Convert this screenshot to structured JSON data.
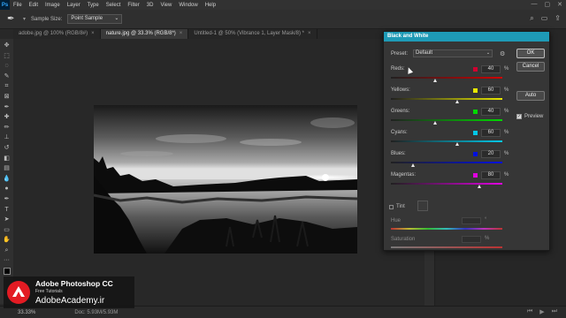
{
  "menubar": {
    "logo": "Ps",
    "items": [
      "File",
      "Edit",
      "Image",
      "Layer",
      "Type",
      "Select",
      "Filter",
      "3D",
      "View",
      "Window",
      "Help"
    ]
  },
  "options": {
    "sample_size_label": "Sample Size:",
    "sample_size_value": "Point Sample"
  },
  "tabs": [
    {
      "label": "adobe.jpg @ 100% (RGB/8#)",
      "active": false
    },
    {
      "label": "nature.jpg @ 33.3% (RGB/8*)",
      "active": true
    },
    {
      "label": "Untitled-1 @ 50% (Vibrance 1, Layer Mask/8) *",
      "active": false
    }
  ],
  "dialog": {
    "title": "Black and White",
    "preset_label": "Preset:",
    "preset_value": "Default",
    "ok_label": "OK",
    "cancel_label": "Cancel",
    "auto_label": "Auto",
    "preview_label": "Preview",
    "preview_checked": true,
    "sliders": [
      {
        "label": "Reds:",
        "value": "40",
        "percent": 40,
        "color": "#d00030",
        "gradient": [
          "#202020",
          "#d00000"
        ]
      },
      {
        "label": "Yellows:",
        "value": "60",
        "percent": 60,
        "color": "#e8e800",
        "gradient": [
          "#202020",
          "#e8e800"
        ]
      },
      {
        "label": "Greens:",
        "value": "40",
        "percent": 40,
        "color": "#00d800",
        "gradient": [
          "#202020",
          "#00d800"
        ]
      },
      {
        "label": "Cyans:",
        "value": "60",
        "percent": 60,
        "color": "#00c8e8",
        "gradient": [
          "#202020",
          "#00c8e8"
        ]
      },
      {
        "label": "Blues:",
        "value": "20",
        "percent": 20,
        "color": "#0010e0",
        "gradient": [
          "#202020",
          "#0010e0"
        ]
      },
      {
        "label": "Magentas:",
        "value": "80",
        "percent": 80,
        "color": "#e000e0",
        "gradient": [
          "#202020",
          "#e000e0"
        ]
      }
    ],
    "tint_label": "Tint",
    "hue_label": "Hue",
    "saturation_label": "Saturation",
    "percent_sign": "%",
    "degree_sign": "°"
  },
  "status": {
    "zoom": "33.33%",
    "doc": "Doc: 5.93M/5.93M"
  },
  "watermark": {
    "title": "Adobe Photoshop CC",
    "subtitle": "Free Tutorials",
    "site": "AdobeAcademy.ir"
  }
}
